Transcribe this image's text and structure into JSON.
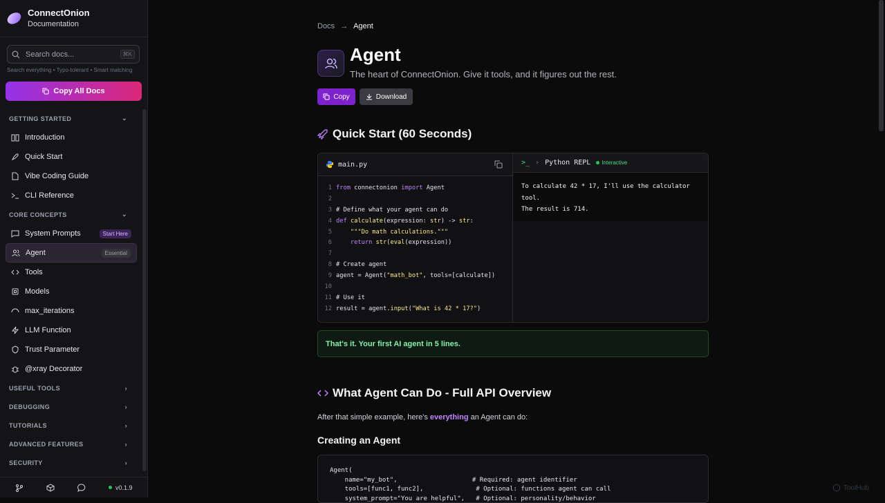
{
  "brand": {
    "title": "ConnectOnion",
    "subtitle": "Documentation"
  },
  "search": {
    "placeholder": "Search docs...",
    "shortcut": "⌘K",
    "hint": "Search everything • Typo-tolerant • Smart matching"
  },
  "copy_all": {
    "label": "Copy All Docs"
  },
  "sidebar": {
    "sections": [
      {
        "title": "GETTING STARTED",
        "expanded": true,
        "items": [
          {
            "label": "Introduction",
            "icon": "book-icon"
          },
          {
            "label": "Quick Start",
            "icon": "rocket-icon"
          },
          {
            "label": "Vibe Coding Guide",
            "icon": "file-icon"
          },
          {
            "label": "CLI Reference",
            "icon": "terminal-icon"
          }
        ]
      },
      {
        "title": "CORE CONCEPTS",
        "expanded": true,
        "items": [
          {
            "label": "System Prompts",
            "icon": "message-icon",
            "badge": "Start Here"
          },
          {
            "label": "Agent",
            "icon": "users-icon",
            "badge": "Essential",
            "active": true
          },
          {
            "label": "Tools",
            "icon": "code-icon"
          },
          {
            "label": "Models",
            "icon": "cpu-icon"
          },
          {
            "label": "max_iterations",
            "icon": "loop-icon"
          },
          {
            "label": "LLM Function",
            "icon": "bolt-icon"
          },
          {
            "label": "Trust Parameter",
            "icon": "shield-icon"
          },
          {
            "label": "@xray Decorator",
            "icon": "bug-icon"
          }
        ]
      },
      {
        "title": "USEFUL TOOLS",
        "expanded": false
      },
      {
        "title": "DEBUGGING",
        "expanded": false
      },
      {
        "title": "TUTORIALS",
        "expanded": false
      },
      {
        "title": "ADVANCED FEATURES",
        "expanded": false
      },
      {
        "title": "SECURITY",
        "expanded": false
      }
    ]
  },
  "footer": {
    "version": "v0.1.9"
  },
  "breadcrumb": {
    "parent": "Docs",
    "current": "Agent"
  },
  "page": {
    "title": "Agent",
    "subtitle": "The heart of ConnectOnion. Give it tools, and it figures out the rest.",
    "copy_label": "Copy",
    "download_label": "Download"
  },
  "quickstart": {
    "heading": "Quick Start (60 Seconds)",
    "filename": "main.py",
    "repl_title": "Python REPL",
    "repl_badge": "Interactive",
    "repl_output": [
      "To calculate 42 * 17, I'll use the calculator",
      "tool.",
      "The result is 714."
    ],
    "success": "That's it. Your first AI agent in 5 lines."
  },
  "api": {
    "heading": "What Agent Can Do - Full API Overview",
    "intro_before": "After that simple example, here's ",
    "intro_highlight": "everything",
    "intro_after": " an Agent can do:",
    "subheading": "Creating an Agent",
    "code": "Agent(\n    name=\"my_bot\",                    # Required: agent identifier\n    tools=[func1, func2],              # Optional: functions agent can call\n    system_prompt=\"You are helpful\",   # Optional: personality/behavior"
  },
  "watermark": "ToolHub",
  "colors": {
    "accent": "#9333ea",
    "accent2": "#db2777",
    "success": "#86efac",
    "bg": "#0b0b0c"
  }
}
